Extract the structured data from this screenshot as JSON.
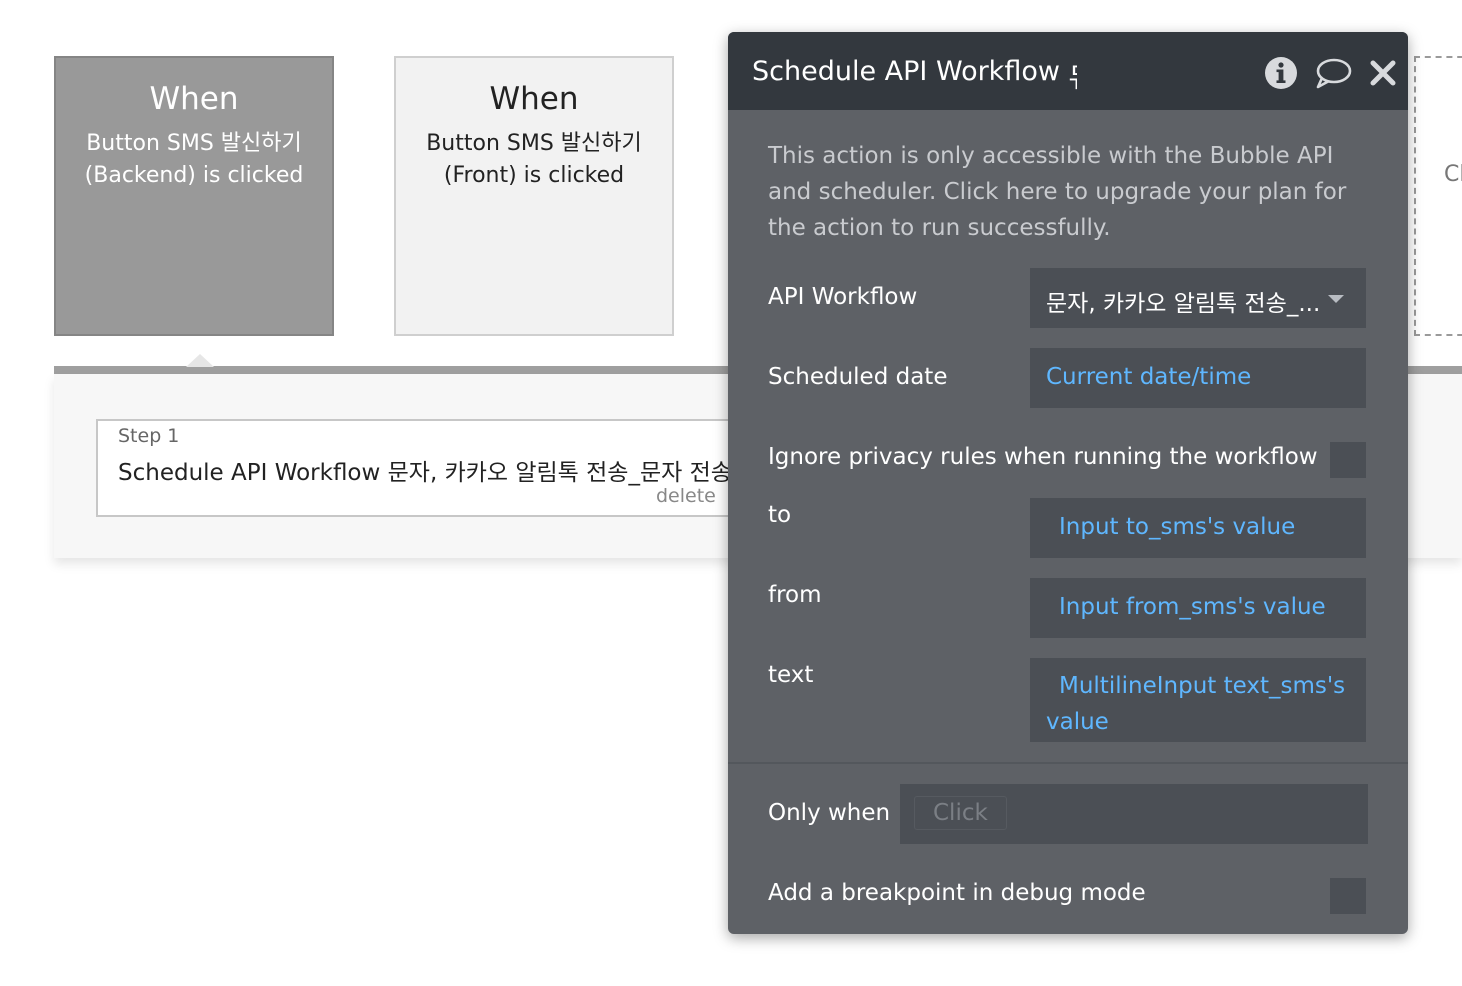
{
  "events": [
    {
      "when": "When",
      "description": "Button SMS 발신하기 (Backend) is clicked"
    },
    {
      "when": "When",
      "description": "Button SMS 발신하기 (Front) is clicked"
    }
  ],
  "partial_event_text": "Cl",
  "step": {
    "label": "Step 1",
    "title": "Schedule API Workflow 문자, 카카오 알림톡 전송_문자 전송",
    "delete_label": "delete"
  },
  "panel": {
    "title": "Schedule API Workflow",
    "title_cut_glyph": "듀",
    "notice": "This action is only accessible with the Bubble API and scheduler. Click here to upgrade your plan for the action to run successfully.",
    "api_workflow": {
      "label": "API Workflow",
      "value": "문자, 카카오 알림톡 전송_..."
    },
    "scheduled_date": {
      "label": "Scheduled date",
      "value": "Current date/time"
    },
    "ignore_privacy": {
      "label": "Ignore privacy rules when running the workflow",
      "checked": false
    },
    "params": [
      {
        "label": "to",
        "value": "Input to_sms's value"
      },
      {
        "label": "from",
        "value": "Input from_sms's value"
      },
      {
        "label": "text",
        "value_line1": "MultilineInput text_sms's",
        "value_line2": "value"
      }
    ],
    "only_when": {
      "label": "Only when",
      "placeholder": "Click"
    },
    "breakpoint": {
      "label": "Add a breakpoint in debug mode",
      "checked": false
    }
  },
  "colors": {
    "panel_bg": "#5e6166",
    "header_bg": "#33383e",
    "field_bg": "#4b4f55",
    "expression": "#5fb7ff",
    "active_event": "#999999"
  },
  "icons": [
    "info-icon",
    "comment-icon",
    "close-icon",
    "chevron-down-icon"
  ]
}
